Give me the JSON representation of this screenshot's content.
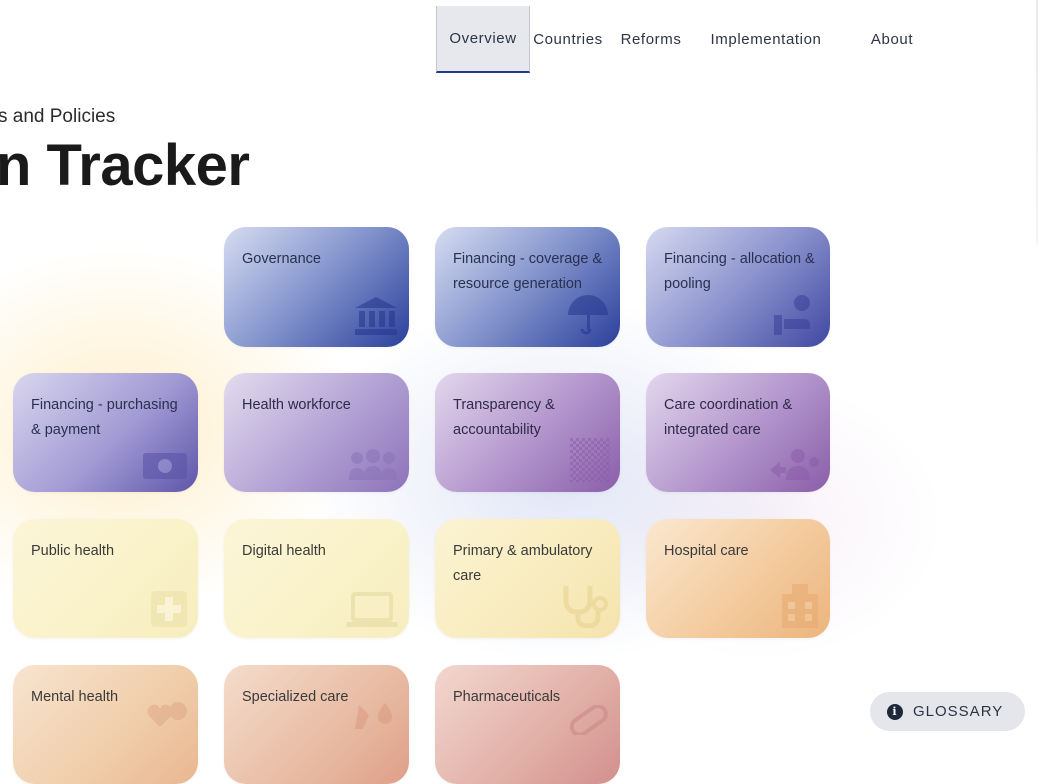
{
  "nav": {
    "items": [
      {
        "label": "Overview",
        "active": true
      },
      {
        "label": "Countries",
        "active": false
      },
      {
        "label": "Reforms",
        "active": false
      },
      {
        "label": "Implementation",
        "active": false
      },
      {
        "label": "About",
        "active": false
      }
    ]
  },
  "header": {
    "subtitle": "s and Policies",
    "title": "n Tracker"
  },
  "tiles": [
    {
      "label": "Governance",
      "icon": "bank-icon"
    },
    {
      "label": "Financing - coverage & resource generation",
      "icon": "umbrella-icon"
    },
    {
      "label": "Financing - allocation & pooling",
      "icon": "hand-person-icon"
    },
    {
      "label": "Financing - purchasing & payment",
      "icon": "money-bill-icon"
    },
    {
      "label": "Health workforce",
      "icon": "people-group-icon"
    },
    {
      "label": "Transparency & accountability",
      "icon": "checker-pattern-icon"
    },
    {
      "label": "Care coordination & integrated care",
      "icon": "people-arrows-icon"
    },
    {
      "label": "Public health",
      "icon": "medical-cross-icon"
    },
    {
      "label": "Digital health",
      "icon": "laptop-icon"
    },
    {
      "label": "Primary & ambulatory care",
      "icon": "stethoscope-icon"
    },
    {
      "label": "Hospital care",
      "icon": "hospital-icon"
    },
    {
      "label": "Mental health",
      "icon": "brain-heart-icon"
    },
    {
      "label": "Specialized care",
      "icon": "hand-drop-icon"
    },
    {
      "label": "Pharmaceuticals",
      "icon": "pill-icon"
    }
  ],
  "glossary": {
    "label": "GLOSSARY",
    "icon": "info-icon"
  },
  "colors": {
    "nav_active_bg": "#e7e8ee",
    "nav_active_underline": "#1e3a8a",
    "text_dark": "#1a1a1a"
  }
}
